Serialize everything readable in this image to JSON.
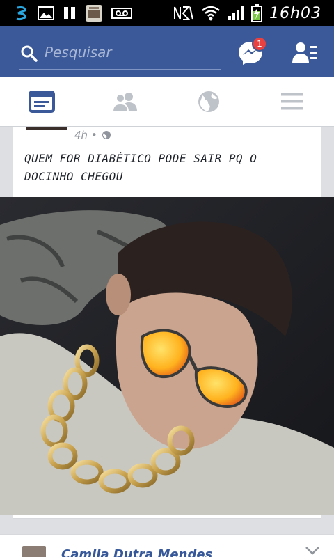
{
  "status_bar": {
    "time": "16h03",
    "icons": [
      "app-notification-icon",
      "image-icon",
      "pause-icon",
      "app-thumb-icon",
      "voicemail-icon",
      "nfc-icon",
      "wifi-icon",
      "signal-icon",
      "battery-charging-icon"
    ]
  },
  "top_bar": {
    "search_placeholder": "Pesquisar",
    "messenger_badge": "1",
    "brand_color": "#3b5998"
  },
  "nav_tabs": [
    {
      "name": "feed",
      "icon": "news-feed-icon",
      "active": true
    },
    {
      "name": "friends",
      "icon": "friends-icon",
      "active": false
    },
    {
      "name": "notifications",
      "icon": "globe-icon",
      "active": false
    },
    {
      "name": "menu",
      "icon": "hamburger-menu-icon",
      "active": false
    }
  ],
  "post": {
    "time": "4h •",
    "text": "QUEM FOR DIABÉTICO PODE SAIR PQ O DOCINHO CHEGOU",
    "image_caption": ""
  },
  "next_post": {
    "author": "Camila Dutra Mendes"
  }
}
